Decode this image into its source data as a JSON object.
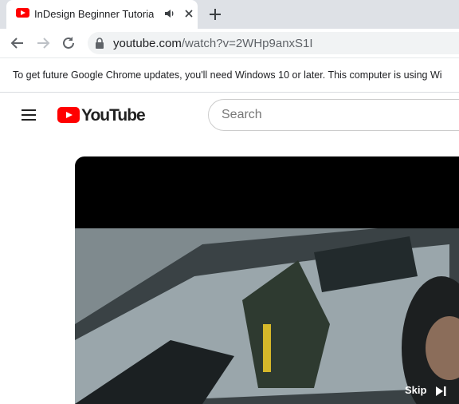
{
  "browser": {
    "tab": {
      "title": "InDesign Beginner Tutorial -",
      "favicon": "youtube-favicon",
      "audio_icon": "speaker-icon",
      "close_icon": "close-icon"
    },
    "new_tab_icon": "plus-icon",
    "nav": {
      "back_icon": "arrow-left-icon",
      "forward_icon": "arrow-right-icon",
      "reload_icon": "reload-icon"
    },
    "address": {
      "lock_icon": "lock-icon",
      "domain": "youtube.com",
      "path": "/watch?v=2WHp9anxS1I"
    },
    "infobar": {
      "text": "To get future Google Chrome updates, you'll need Windows 10 or later. This computer is using Wi"
    }
  },
  "youtube": {
    "menu_icon": "hamburger-menu-icon",
    "logo_text": "YouTube",
    "search_placeholder": "Search",
    "player": {
      "skip_label": "Skip",
      "skip_icon": "skip-next-icon"
    }
  },
  "colors": {
    "brand": "#ff0000",
    "tabstrip": "#dee1e6",
    "omnibox": "#f1f3f4",
    "player_bg": "#000000"
  }
}
